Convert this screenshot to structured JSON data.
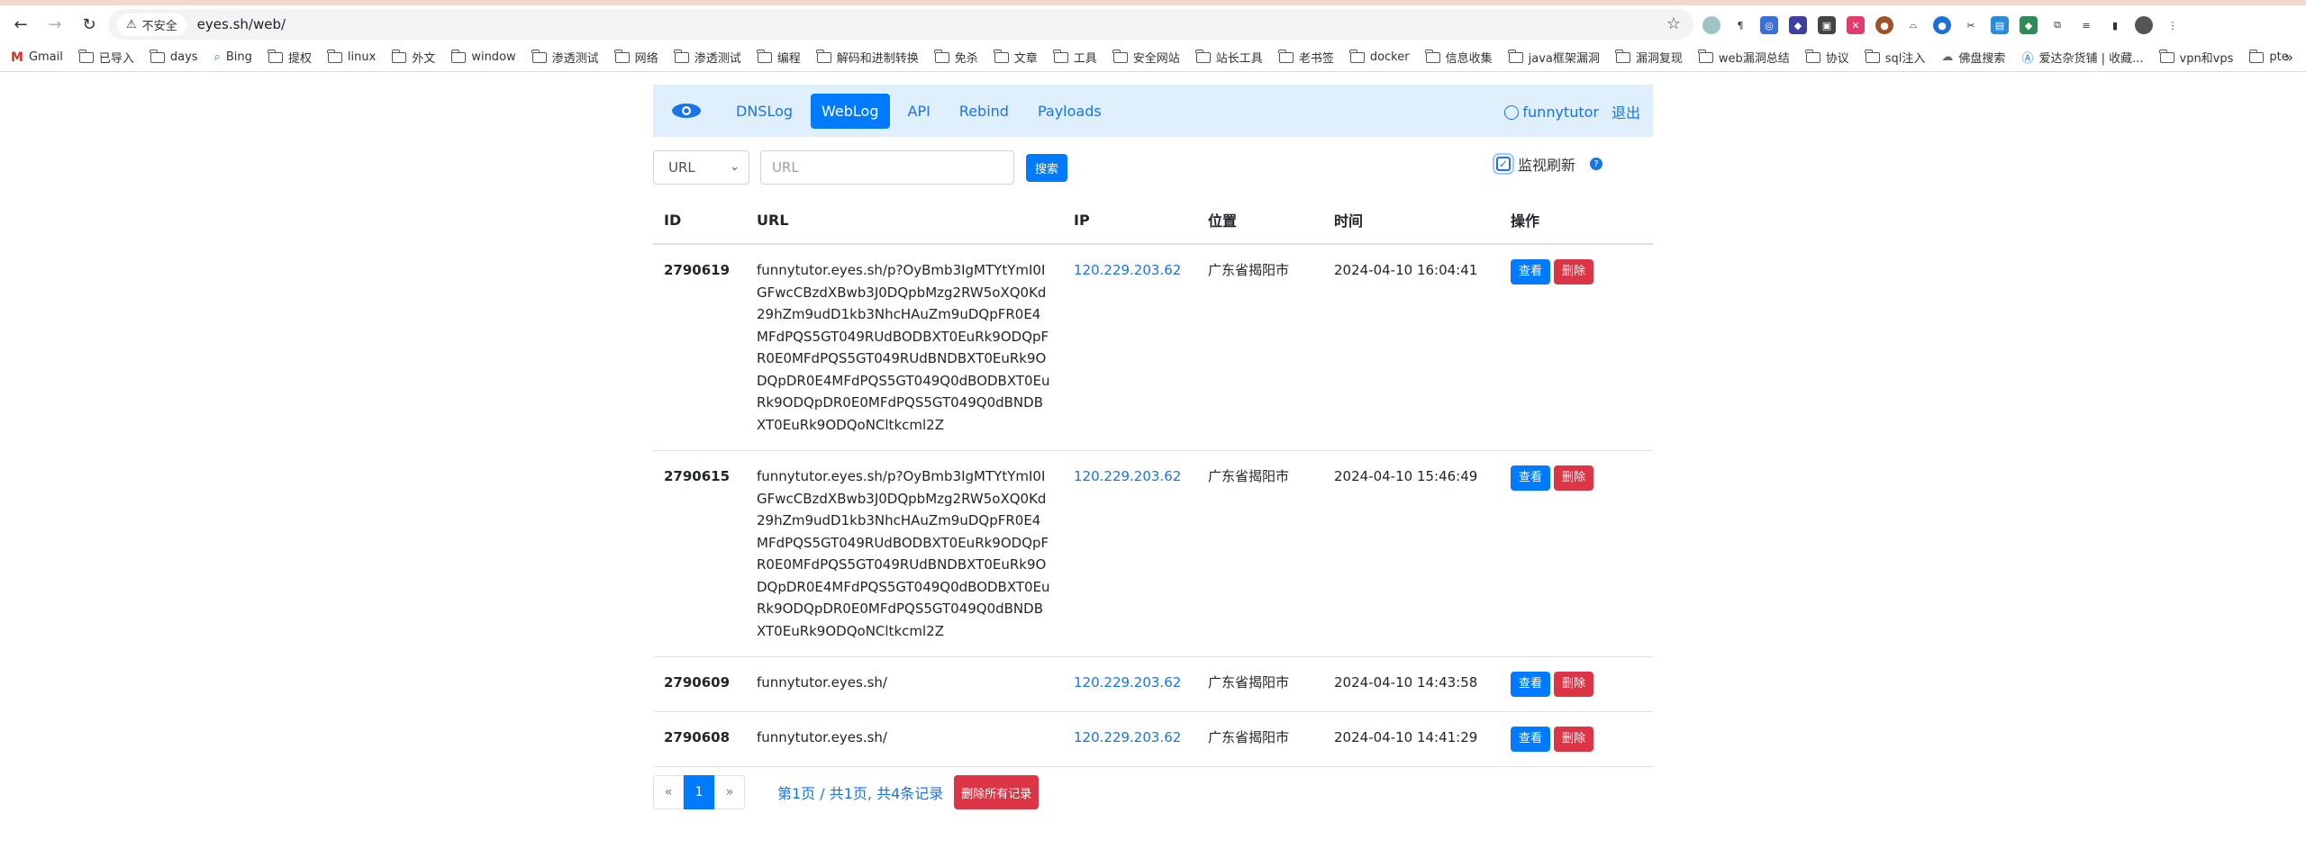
{
  "browser": {
    "security_label": "不安全",
    "url": "eyes.sh/web/",
    "bookmarks": [
      "Gmail",
      "已导入",
      "days",
      "Bing",
      "提权",
      "linux",
      "外文",
      "window",
      "渗透测试",
      "网络",
      "渗透测试",
      "编程",
      "解码和进制转换",
      "免杀",
      "文章",
      "工具",
      "安全网站",
      "站长工具",
      "老书签",
      "docker",
      "信息收集",
      "java框架漏洞",
      "漏洞复现",
      "web漏洞总结",
      "协议",
      "sql注入",
      "佛盘搜索",
      "爱达杂货铺 | 收藏...",
      "vpn和vps",
      "pte"
    ]
  },
  "nav": {
    "links": [
      "DNSLog",
      "WebLog",
      "API",
      "Rebind",
      "Payloads"
    ],
    "active": "WebLog",
    "username": "funnytutor",
    "logout": "退出"
  },
  "search": {
    "select_value": "URL",
    "input_placeholder": "URL",
    "button": "搜索",
    "monitor_label": "监视刷新"
  },
  "table": {
    "headers": [
      "ID",
      "URL",
      "IP",
      "位置",
      "时间",
      "操作"
    ],
    "rows": [
      {
        "id": "2790619",
        "url": "funnytutor.eyes.sh/p?OyBmb3IgMTYtYmI0IGFwcCBzdXBwb3J0DQpbMzg2RW5oXQ0Kd29hZm9udD1kb3NhcHAuZm9uDQpFR0E4MFdPQS5GT049RUdBODBXT0EuRk9ODQpFR0E0MFdPQS5GT049RUdBNDBXT0EuRk9ODQpDR0E4MFdPQS5GT049Q0dBODBXT0EuRk9ODQpDR0E0MFdPQS5GT049Q0dBNDBXT0EuRk9ODQoNCltkcml2Z",
        "ip": "120.229.203.62",
        "location": "广东省揭阳市",
        "time": "2024-04-10 16:04:41"
      },
      {
        "id": "2790615",
        "url": "funnytutor.eyes.sh/p?OyBmb3IgMTYtYmI0IGFwcCBzdXBwb3J0DQpbMzg2RW5oXQ0Kd29hZm9udD1kb3NhcHAuZm9uDQpFR0E4MFdPQS5GT049RUdBODBXT0EuRk9ODQpFR0E0MFdPQS5GT049RUdBNDBXT0EuRk9ODQpDR0E4MFdPQS5GT049Q0dBODBXT0EuRk9ODQpDR0E0MFdPQS5GT049Q0dBNDBXT0EuRk9ODQoNCltkcml2Z",
        "ip": "120.229.203.62",
        "location": "广东省揭阳市",
        "time": "2024-04-10 15:46:49"
      },
      {
        "id": "2790609",
        "url": "funnytutor.eyes.sh/",
        "ip": "120.229.203.62",
        "location": "广东省揭阳市",
        "time": "2024-04-10 14:43:58"
      },
      {
        "id": "2790608",
        "url": "funnytutor.eyes.sh/",
        "ip": "120.229.203.62",
        "location": "广东省揭阳市",
        "time": "2024-04-10 14:41:29"
      }
    ],
    "view_label": "查看",
    "delete_label": "删除"
  },
  "pager": {
    "prev": "«",
    "current": "1",
    "next": "»",
    "info": "第1页 / 共1页, 共4条记录",
    "delete_all": "删除所有记录"
  }
}
